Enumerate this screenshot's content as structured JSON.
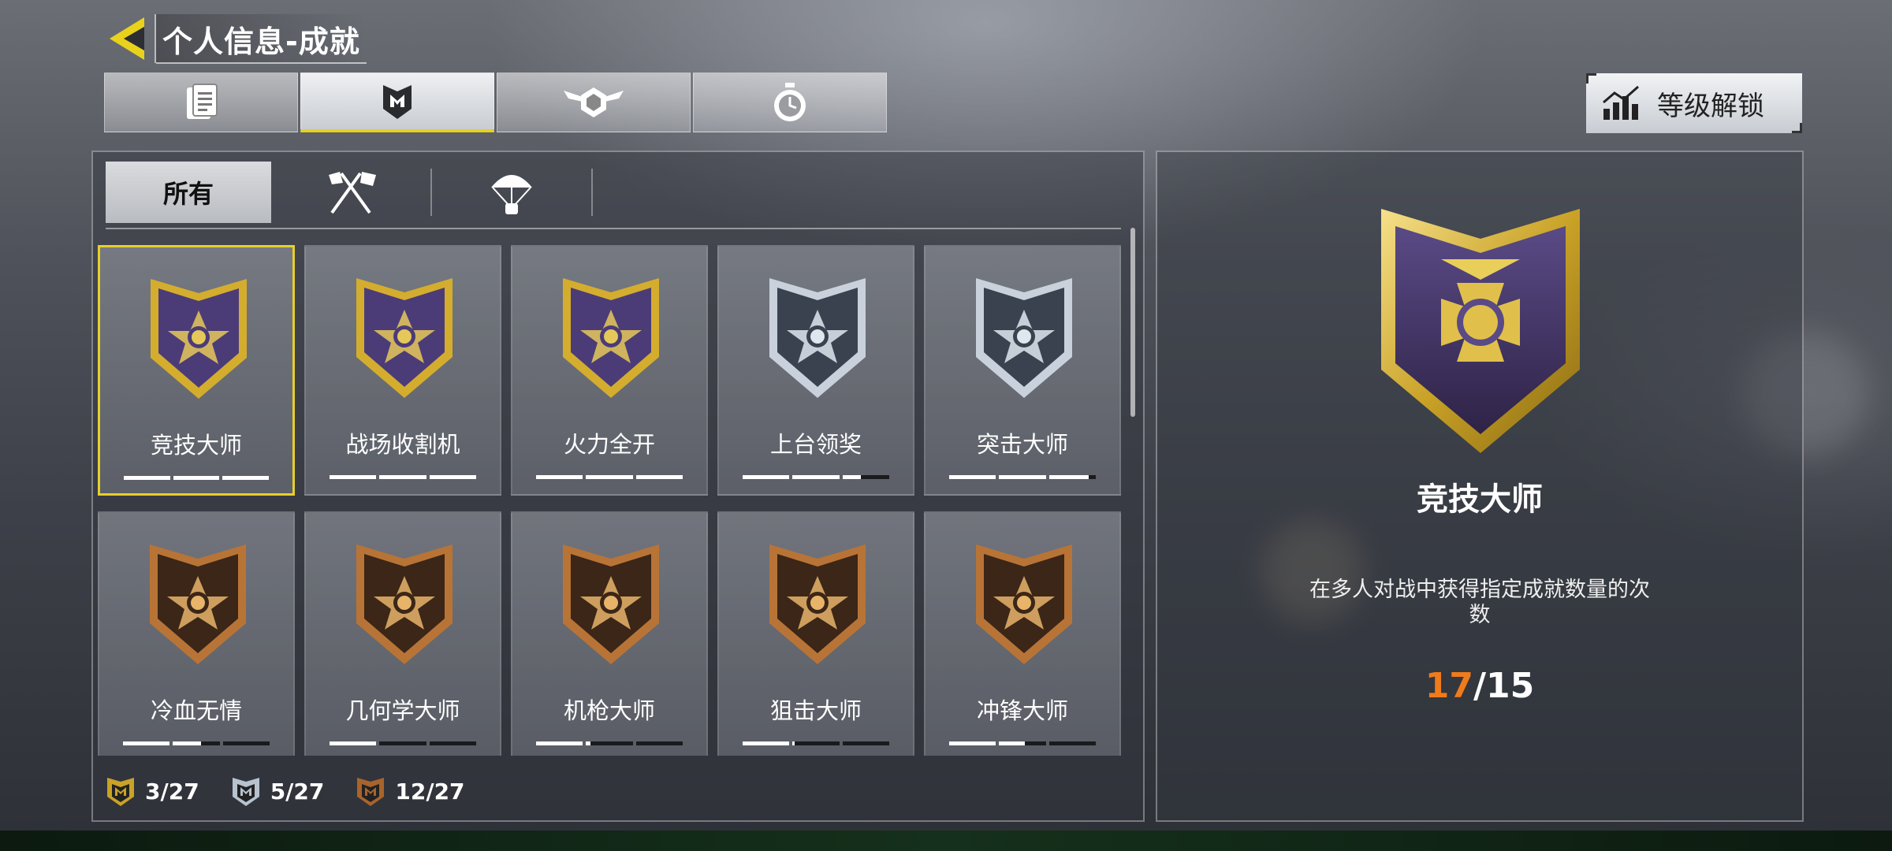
{
  "header": {
    "title": "个人信息-成就"
  },
  "top_tabs": [
    {
      "icon": "list-document-icon"
    },
    {
      "icon": "shield-badge-icon",
      "active": true
    },
    {
      "icon": "winged-emblem-icon"
    },
    {
      "icon": "stopwatch-icon"
    }
  ],
  "unlock_button": {
    "label": "等级解锁",
    "icon": "rank-chart-icon"
  },
  "category_tabs": {
    "all_label": "所有",
    "icons": [
      "crossed-swords-flags-icon",
      "parachute-icon"
    ]
  },
  "achievements": [
    {
      "name": "竞技大师",
      "tier": "gold",
      "emblem": "cross-medal-icon",
      "progress": [
        1,
        1,
        1
      ],
      "selected": true
    },
    {
      "name": "战场收割机",
      "tier": "gold",
      "emblem": "skull-helmet-icon",
      "progress": [
        1,
        1,
        1
      ]
    },
    {
      "name": "火力全开",
      "tier": "gold",
      "emblem": "jet-plane-icon",
      "progress": [
        1,
        1,
        1
      ]
    },
    {
      "name": "上台领奖",
      "tier": "silver",
      "emblem": "trophy-star-icon",
      "progress": [
        1,
        1,
        0.4
      ]
    },
    {
      "name": "突击大师",
      "tier": "silver",
      "emblem": "assault-rifle-icon",
      "progress": [
        1,
        1,
        0.85
      ]
    },
    {
      "name": "冷血无情",
      "tier": "bronze",
      "emblem": "wolf-head-icon",
      "progress": [
        1,
        0.6,
        0
      ]
    },
    {
      "name": "几何学大师",
      "tier": "bronze",
      "emblem": "boom-grenade-icon",
      "progress": [
        1,
        0,
        0
      ]
    },
    {
      "name": "机枪大师",
      "tier": "bronze",
      "emblem": "machine-gun-icon",
      "progress": [
        1,
        0.1,
        0
      ]
    },
    {
      "name": "狙击大师",
      "tier": "bronze",
      "emblem": "sniper-rifle-icon",
      "progress": [
        1,
        0.05,
        0
      ]
    },
    {
      "name": "冲锋大师",
      "tier": "bronze",
      "emblem": "smg-icon",
      "progress": [
        1,
        0.55,
        0
      ]
    }
  ],
  "counts": {
    "gold": "3/27",
    "silver": "5/27",
    "bronze": "12/27"
  },
  "detail": {
    "name": "竞技大师",
    "description": "在多人对战中获得指定成就数量的次数",
    "current": "17",
    "total": "/15"
  },
  "colors": {
    "gold": "#c9a227",
    "silver": "#b7c2cf",
    "bronze": "#a8642c",
    "accent": "#e8d21c",
    "progress_current": "#f07b1a"
  }
}
